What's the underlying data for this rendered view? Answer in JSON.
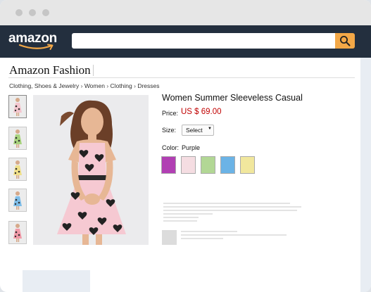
{
  "window": {
    "controls": [
      "close",
      "minimize",
      "maximize"
    ]
  },
  "navbar": {
    "logo_text": "amazon",
    "search": {
      "placeholder": "",
      "value": ""
    },
    "search_icon": "magnifier-icon"
  },
  "page": {
    "section_title": "Amazon Fashion",
    "breadcrumb": [
      "Clothing, Shoes & Jewelry",
      "Women",
      "Clothing",
      "Dresses"
    ],
    "breadcrumb_separator": "›"
  },
  "product": {
    "title": "Women Summer Sleeveless Casual",
    "price_label": "Price:",
    "price": "US $ 69.00",
    "size_label": "Size:",
    "size_selected": "Select",
    "color_label": "Color:",
    "color_selected": "Purple",
    "swatches": [
      "#b13fb3",
      "#f5dde2",
      "#b2d795",
      "#6bb3e6",
      "#f1e79d"
    ],
    "thumbnail_count": 5
  },
  "colors": {
    "navbar": "#232f3e",
    "search_button": "#f3a847",
    "price": "#c00000"
  }
}
